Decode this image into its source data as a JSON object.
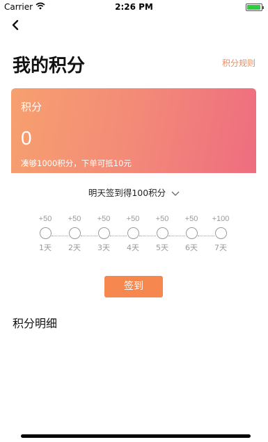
{
  "status_bar": {
    "carrier": "Carrier",
    "time": "2:26 PM"
  },
  "header": {
    "title": "我的积分",
    "rules_label": "积分规则"
  },
  "card": {
    "label": "积分",
    "value": "0",
    "hint": "凑够1000积分，下单可抵10元"
  },
  "checkin": {
    "tomorrow_text": "明天签到得100积分",
    "days": [
      {
        "bonus": "+50",
        "label": "1天"
      },
      {
        "bonus": "+50",
        "label": "2天"
      },
      {
        "bonus": "+50",
        "label": "3天"
      },
      {
        "bonus": "+50",
        "label": "4天"
      },
      {
        "bonus": "+50",
        "label": "5天"
      },
      {
        "bonus": "+50",
        "label": "6天"
      },
      {
        "bonus": "+100",
        "label": "7天"
      }
    ],
    "sign_label": "签到"
  },
  "detail": {
    "title": "积分明细"
  },
  "colors": {
    "accent": "#f6884f",
    "card_start": "#f7a06f",
    "card_end": "#ee6d80"
  }
}
